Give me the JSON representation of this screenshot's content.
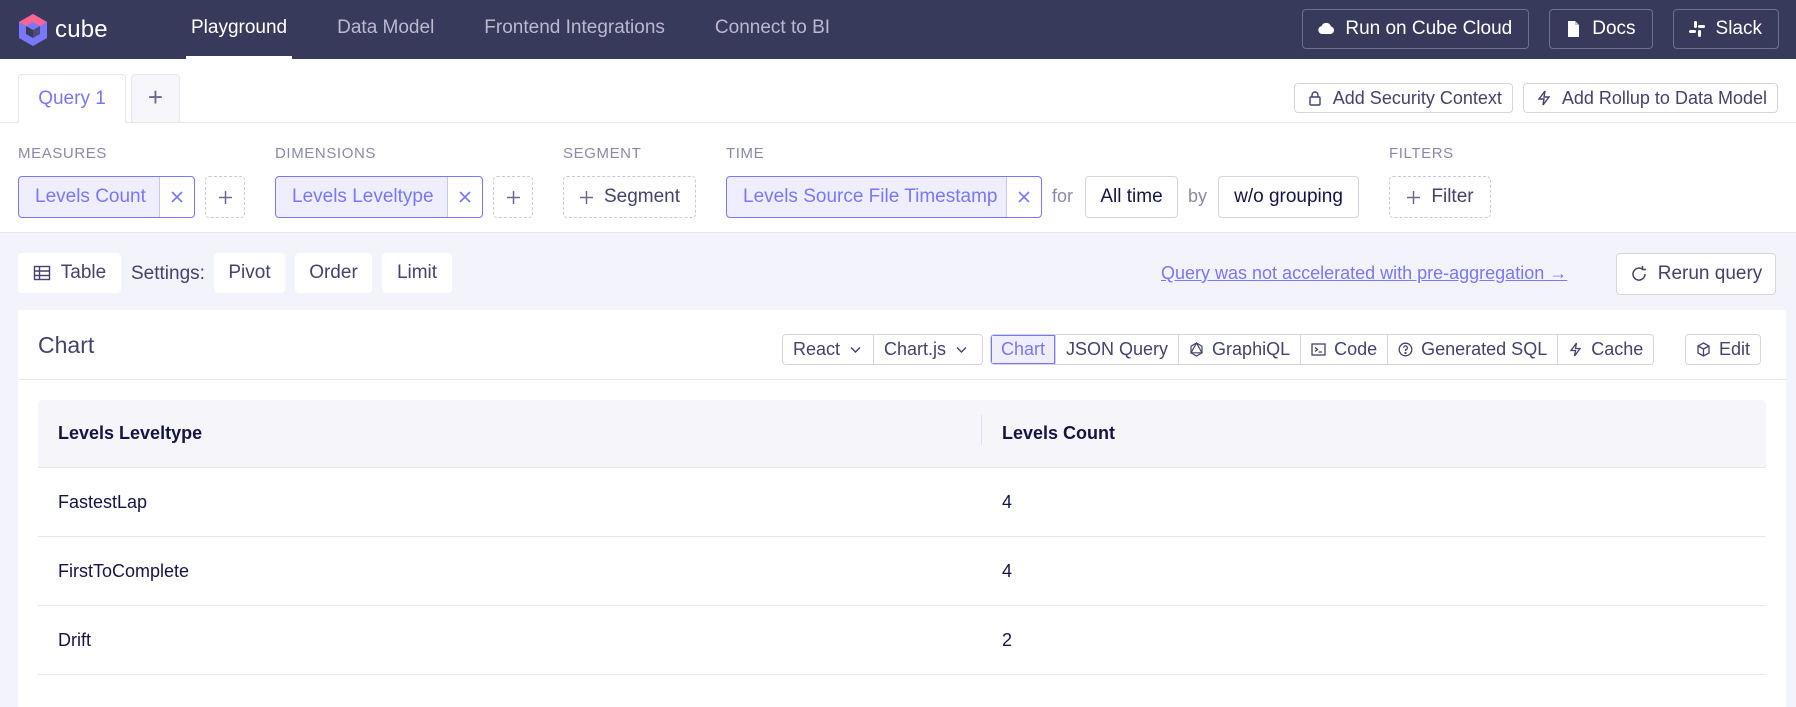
{
  "app": {
    "name": "cube"
  },
  "nav": {
    "links": [
      "Playground",
      "Data Model",
      "Frontend Integrations",
      "Connect to BI"
    ],
    "active_index": 0,
    "buttons": {
      "cloud": "Run on Cube Cloud",
      "docs": "Docs",
      "slack": "Slack"
    }
  },
  "queries": {
    "tabs": [
      "Query 1"
    ],
    "add_label": "+",
    "security": "Add Security Context",
    "rollup": "Add Rollup to Data Model"
  },
  "builder": {
    "measures": {
      "label": "MEASURES",
      "items": [
        "Levels Count"
      ]
    },
    "dimensions": {
      "label": "DIMENSIONS",
      "items": [
        "Levels Leveltype"
      ]
    },
    "segment": {
      "label": "SEGMENT",
      "button": "Segment"
    },
    "time": {
      "label": "TIME",
      "item": "Levels Source File Timestamp",
      "for_text": "for",
      "range": "All time",
      "by_text": "by",
      "grouping": "w/o grouping"
    },
    "filters": {
      "label": "FILTERS",
      "button": "Filter"
    }
  },
  "settings": {
    "view": "Table",
    "label": "Settings:",
    "pivot": "Pivot",
    "order": "Order",
    "limit": "Limit",
    "accel_notice": "Query was not accelerated with pre-aggregation →",
    "rerun": "Rerun query"
  },
  "chart_card": {
    "title": "Chart",
    "framework": "React",
    "library": "Chart.js",
    "tabs": [
      "Chart",
      "JSON Query",
      "GraphiQL",
      "Code",
      "Generated SQL",
      "Cache"
    ],
    "active_tab": "Chart",
    "edit": "Edit"
  },
  "table": {
    "columns": [
      "Levels Leveltype",
      "Levels Count"
    ],
    "rows": [
      [
        "FastestLap",
        "4"
      ],
      [
        "FirstToComplete",
        "4"
      ],
      [
        "Drift",
        "2"
      ]
    ]
  },
  "colors": {
    "nav_bg": "#383a5c",
    "accent": "#7a77ff",
    "page_bg": "#f3f3fb"
  }
}
